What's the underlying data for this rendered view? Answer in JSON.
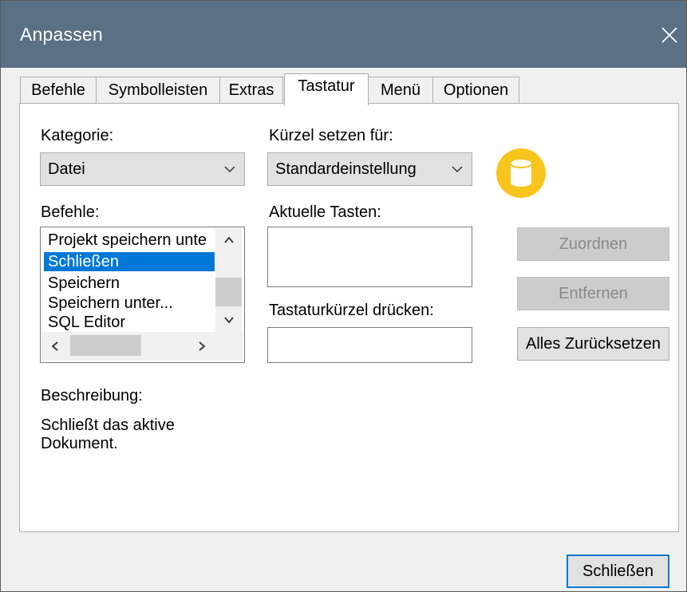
{
  "window": {
    "title": "Anpassen"
  },
  "tabs": [
    {
      "label": "Befehle"
    },
    {
      "label": "Symbolleisten"
    },
    {
      "label": "Extras"
    },
    {
      "label": "Tastatur"
    },
    {
      "label": "Menü"
    },
    {
      "label": "Optionen"
    }
  ],
  "active_tab": "Tastatur",
  "category": {
    "label": "Kategorie:",
    "value": "Datei"
  },
  "shortcut_for": {
    "label": "Kürzel setzen für:",
    "value": "Standardeinstellung"
  },
  "commands": {
    "label": "Befehle:",
    "items": [
      "Projekt speichern unte",
      "Schließen",
      "Speichern",
      "Speichern unter...",
      "SQL Editor"
    ],
    "selected": "Schließen"
  },
  "current_keys": {
    "label": "Aktuelle Tasten:",
    "value": ""
  },
  "press_shortcut": {
    "label": "Tastaturkürzel drücken:",
    "value": ""
  },
  "buttons": {
    "assign": "Zuordnen",
    "remove": "Entfernen",
    "reset_all": "Alles Zurücksetzen",
    "close": "Schließen"
  },
  "description": {
    "label": "Beschreibung:",
    "line1": "Schließt das aktive",
    "line2": "Dokument."
  },
  "colors": {
    "titlebar": "#5a7085",
    "selection": "#0078d7",
    "info_icon": "#f8c51d"
  },
  "icons": {
    "close": "close-icon",
    "info": "database-icon"
  }
}
